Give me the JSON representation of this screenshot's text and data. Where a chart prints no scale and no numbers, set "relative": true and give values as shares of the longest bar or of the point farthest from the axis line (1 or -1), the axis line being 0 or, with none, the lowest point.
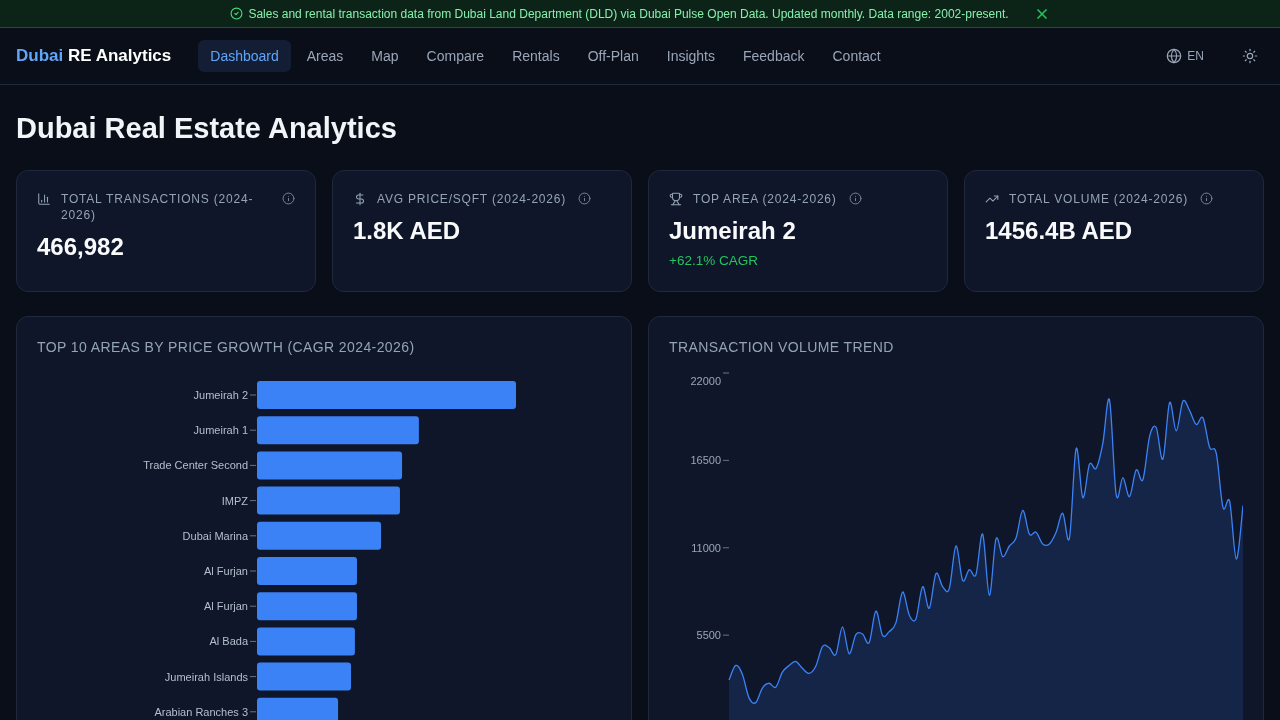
{
  "banner": {
    "text": "Sales and rental transaction data from Dubai Land Department (DLD) via Dubai Pulse Open Data. Updated monthly. Data range: 2002-present."
  },
  "nav": {
    "brand": {
      "accent": "Dubai",
      "name": "RE Analytics"
    },
    "items": [
      {
        "label": "Dashboard",
        "selected": true
      },
      {
        "label": "Areas",
        "selected": false
      },
      {
        "label": "Map",
        "selected": false
      },
      {
        "label": "Compare",
        "selected": false
      },
      {
        "label": "Rentals",
        "selected": false
      },
      {
        "label": "Off-Plan",
        "selected": false
      },
      {
        "label": "Insights",
        "selected": false
      },
      {
        "label": "Feedback",
        "selected": false
      },
      {
        "label": "Contact",
        "selected": false
      }
    ],
    "language": "EN"
  },
  "page_title": "Dubai Real Estate Analytics",
  "stats": [
    {
      "label": "TOTAL TRANSACTIONS (2024-2026)",
      "value": "466,982"
    },
    {
      "label": "AVG PRICE/SQFT (2024-2026)",
      "value": "1.8K AED"
    },
    {
      "label": "TOP AREA (2024-2026)",
      "value": "Jumeirah 2",
      "note": "+62.1% CAGR"
    },
    {
      "label": "TOTAL VOLUME (2024-2026)",
      "value": "1456.4B AED"
    }
  ],
  "price_growth_chart": {
    "chart_data": {
      "type": "bar",
      "orientation": "horizontal",
      "relative": true,
      "title": "TOP 10 AREAS BY PRICE GROWTH (CAGR 2024-2026)",
      "categories": [
        "Jumeirah 2",
        "Jumeirah 1",
        "Trade Center Second",
        "IMPZ",
        "Dubai Marina",
        "Al Furjan",
        "Al Furjan",
        "Al Bada",
        "Jumeirah Islands",
        "Arabian Ranches 3"
      ],
      "values": [
        1,
        0.625,
        0.56,
        0.552,
        0.479,
        0.386,
        0.386,
        0.378,
        0.363,
        0.313
      ]
    }
  },
  "volume_trend_chart": {
    "chart_data": {
      "type": "area",
      "title": "TRANSACTION VOLUME TREND",
      "ylim": [
        0,
        22000
      ],
      "yticks": [
        5500,
        11000,
        16500,
        22000
      ],
      "series": [
        {
          "color": "#3b82f6",
          "values": [
            2670,
            3590,
            3040,
            1550,
            1250,
            2170,
            2470,
            2220,
            3170,
            3590,
            3840,
            3410,
            3090,
            3540,
            4780,
            4710,
            4280,
            6020,
            4330,
            5530,
            5570,
            5030,
            7010,
            5480,
            5720,
            6270,
            8210,
            6770,
            6520,
            8550,
            7190,
            9370,
            8550,
            8430,
            11110,
            8950,
            9620,
            9320,
            11860,
            8010,
            11560,
            10440,
            11110,
            11610,
            13350,
            11860,
            11980,
            11240,
            11240,
            11980,
            13170,
            11610,
            17240,
            14160,
            16250,
            16000,
            17570,
            20300,
            14340,
            15410,
            14220,
            15900,
            15280,
            17990,
            18570,
            16580,
            20130,
            18360,
            20230,
            19630,
            18760,
            19180,
            17320,
            16940,
            13540,
            13910,
            10290,
            13660
          ]
        }
      ]
    }
  }
}
